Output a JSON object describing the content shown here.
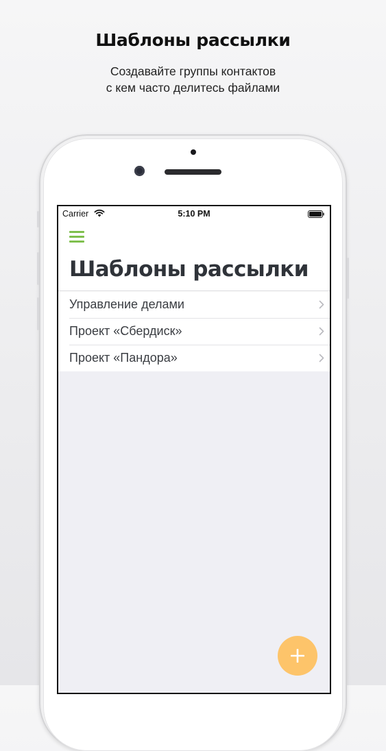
{
  "promo": {
    "title": "Шаблоны рассылки",
    "subtitle_line1": "Создавайте группы контактов",
    "subtitle_line2": "с кем часто делитесь файлами"
  },
  "status_bar": {
    "carrier": "Carrier",
    "time": "5:10 PM",
    "icons": [
      "wifi-icon",
      "battery-icon"
    ]
  },
  "header": {
    "menu_icon": "hamburger-menu-icon",
    "title": "Шаблоны рассылки"
  },
  "list": {
    "items": [
      {
        "label": "Управление делами",
        "icon": "chevron-right-icon"
      },
      {
        "label": "Проект «Сбердиск»",
        "icon": "chevron-right-icon"
      },
      {
        "label": "Проект «Пандора»",
        "icon": "chevron-right-icon"
      }
    ]
  },
  "fab": {
    "icon": "plus-icon"
  },
  "colors": {
    "accent_green": "#7fbf4d",
    "fab_orange": "#fdc46a",
    "title_text": "#2f3339",
    "list_background": "#efeff4"
  }
}
